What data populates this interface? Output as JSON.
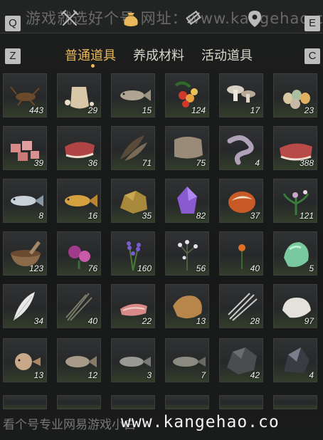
{
  "header": {
    "watermark": "游戏就选好个号 网址：www.kangehao.com",
    "key_left": "Q",
    "key_right": "E",
    "icons": [
      "swords-icon",
      "pouch-icon",
      "scroll-icon",
      "map-pin-icon"
    ]
  },
  "tabs": {
    "key_left": "Z",
    "key_right": "C",
    "items": [
      {
        "label": "普通道具",
        "active": true
      },
      {
        "label": "养成材料",
        "active": false
      },
      {
        "label": "活动道具",
        "active": false
      }
    ]
  },
  "inventory": {
    "rows": [
      [
        {
          "item": "cricket-icon",
          "count": "443"
        },
        {
          "item": "flour-sack-icon",
          "count": "29"
        },
        {
          "item": "small-fish-icon",
          "count": "15"
        },
        {
          "item": "berries-icon",
          "count": "124"
        },
        {
          "item": "mushrooms-icon",
          "count": "17"
        },
        {
          "item": "eggs-icon",
          "count": "23"
        }
      ],
      [
        {
          "item": "raw-meat-chunks-icon",
          "count": "39"
        },
        {
          "item": "steak-icon",
          "count": "36"
        },
        {
          "item": "feathers-icon",
          "count": "71"
        },
        {
          "item": "hide-icon",
          "count": "75"
        },
        {
          "item": "intestine-icon",
          "count": "4"
        },
        {
          "item": "steak-slab-icon",
          "count": "388"
        }
      ],
      [
        {
          "item": "salmon-icon",
          "count": "8"
        },
        {
          "item": "golden-carp-icon",
          "count": "16"
        },
        {
          "item": "ore-chunk-icon",
          "count": "35"
        },
        {
          "item": "amethyst-icon",
          "count": "82"
        },
        {
          "item": "agate-stone-icon",
          "count": "37"
        },
        {
          "item": "herb-plant-icon",
          "count": "121"
        }
      ],
      [
        {
          "item": "mortar-bowl-icon",
          "count": "123"
        },
        {
          "item": "purple-flower-icon",
          "count": "76"
        },
        {
          "item": "lavender-icon",
          "count": "160"
        },
        {
          "item": "white-blossom-icon",
          "count": "56"
        },
        {
          "item": "orange-flower-icon",
          "count": "40"
        },
        {
          "item": "jade-stone-icon",
          "count": "5"
        }
      ],
      [
        {
          "item": "white-feather-icon",
          "count": "34"
        },
        {
          "item": "grass-bundle-icon",
          "count": "40"
        },
        {
          "item": "meat-slices-icon",
          "count": "22"
        },
        {
          "item": "fur-pelt-icon",
          "count": "13"
        },
        {
          "item": "quills-icon",
          "count": "28"
        },
        {
          "item": "white-fleece-icon",
          "count": "97"
        }
      ],
      [
        {
          "item": "pufferfish-icon",
          "count": "13"
        },
        {
          "item": "grouper-icon",
          "count": "12"
        },
        {
          "item": "spotted-fish-icon",
          "count": "3"
        },
        {
          "item": "catfish-icon",
          "count": "7"
        },
        {
          "item": "dark-ore-icon",
          "count": "42"
        },
        {
          "item": "black-crystal-icon",
          "count": "4"
        }
      ]
    ]
  },
  "footer": {
    "watermark_left": "看个号专业网易游戏小白",
    "watermark_right": "www.kangehao.co"
  },
  "colors": {
    "active_tab": "#e8b85a",
    "inactive_tab": "#d8d4c8",
    "background": "#1b1c1c",
    "cell_border": "#3d3e3b"
  }
}
